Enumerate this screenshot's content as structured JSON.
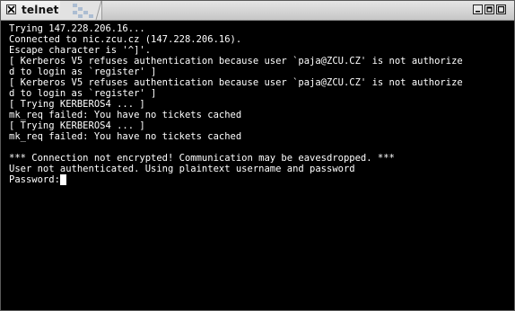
{
  "window": {
    "title": "telnet"
  },
  "terminal": {
    "lines": [
      "Trying 147.228.206.16...",
      "Connected to nic.zcu.cz (147.228.206.16).",
      "Escape character is '^]'.",
      "[ Kerberos V5 refuses authentication because user `paja@ZCU.CZ' is not authorize",
      "d to login as `register' ]",
      "[ Kerberos V5 refuses authentication because user `paja@ZCU.CZ' is not authorize",
      "d to login as `register' ]",
      "[ Trying KERBEROS4 ... ]",
      "mk_req failed: You have no tickets cached",
      "[ Trying KERBEROS4 ... ]",
      "mk_req failed: You have no tickets cached",
      "",
      "*** Connection not encrypted! Communication may be eavesdropped. ***",
      "User not authenticated. Using plaintext username and password"
    ],
    "prompt": "Password:"
  }
}
